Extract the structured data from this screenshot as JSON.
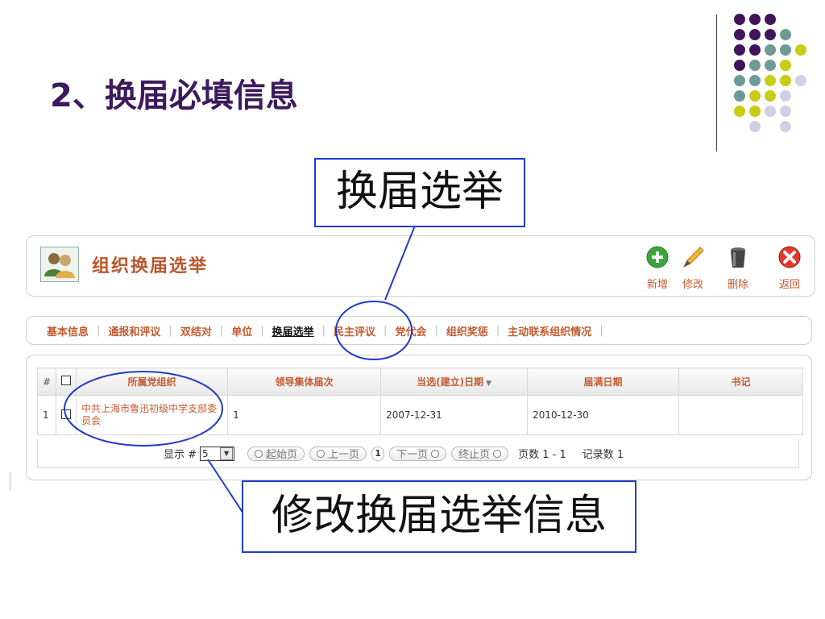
{
  "slide": {
    "title": "2、换届必填信息"
  },
  "callouts": {
    "top": "换届选举",
    "bottom": "修改换届选举信息"
  },
  "header": {
    "title": "组织换届选举",
    "tools": [
      {
        "label": "新增",
        "icon": "add-icon"
      },
      {
        "label": "修改",
        "icon": "pencil-icon"
      },
      {
        "label": "删除",
        "icon": "trash-icon"
      },
      {
        "label": "返回",
        "icon": "close-icon"
      }
    ]
  },
  "tabs": [
    "基本信息",
    "通报和评议",
    "双结对",
    "单位",
    "换届选举",
    "民主评议",
    "党代会",
    "组织奖惩",
    "主动联系组织情况"
  ],
  "active_tab": "换届选举",
  "grid": {
    "columns": [
      "#",
      "",
      "所属党组织",
      "领导集体届次",
      "当选(建立)日期",
      "届满日期",
      "书记"
    ],
    "rows": [
      {
        "index": "1",
        "org": "中共上海市鲁迅初级中学支部委员会",
        "term": "1",
        "elected": "2007-12-31",
        "expires": "2010-12-30",
        "secretary": ""
      }
    ]
  },
  "pager": {
    "show_label": "显示 #",
    "page_size": "5",
    "first": "起始页",
    "prev": "上一页",
    "current": "1",
    "next": "下一页",
    "last": "终止页",
    "pages_text": "页数 1 - 1",
    "records_text": "记录数 1"
  },
  "colors": {
    "accent": "#c35a2f",
    "title_purple": "#3d1a5c",
    "callout_border": "#1f3cc9",
    "dot_purple": "#40155a",
    "dot_teal": "#6d9a94",
    "dot_yellow": "#c7cc14",
    "dot_lilac": "#d0d0e4"
  }
}
